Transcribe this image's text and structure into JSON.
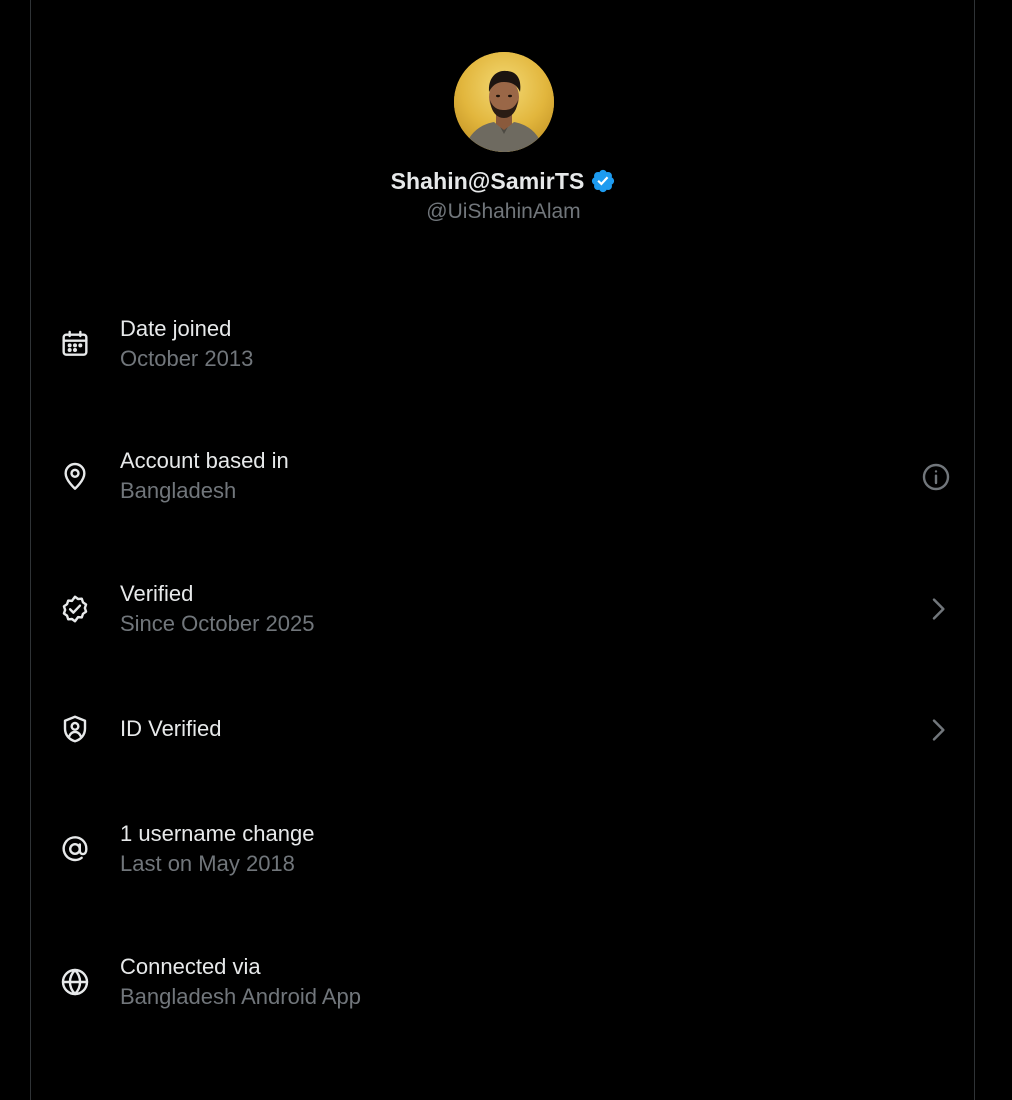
{
  "profile": {
    "display_name": "Shahin@SamirTS",
    "handle": "@UiShahinAlam",
    "verified": true,
    "badge_color": "#1d9bf0"
  },
  "colors": {
    "background": "#000000",
    "primary_text": "#e7e9ea",
    "secondary_text": "#71767b",
    "divider": "#2f3336"
  },
  "info_items": [
    {
      "icon": "calendar-icon",
      "title": "Date joined",
      "subtitle": "October 2013",
      "trailing": null
    },
    {
      "icon": "location-pin-icon",
      "title": "Account based in",
      "subtitle": "Bangladesh",
      "trailing": "info-icon"
    },
    {
      "icon": "verified-badge-icon",
      "title": "Verified",
      "subtitle": "Since October 2025",
      "trailing": "chevron-right-icon"
    },
    {
      "icon": "shield-user-icon",
      "title": "ID Verified",
      "subtitle": "",
      "trailing": "chevron-right-icon"
    },
    {
      "icon": "at-sign-icon",
      "title": "1 username change",
      "subtitle": "Last on May 2018",
      "trailing": null
    },
    {
      "icon": "globe-icon",
      "title": "Connected via",
      "subtitle": "Bangladesh Android App",
      "trailing": null
    }
  ]
}
